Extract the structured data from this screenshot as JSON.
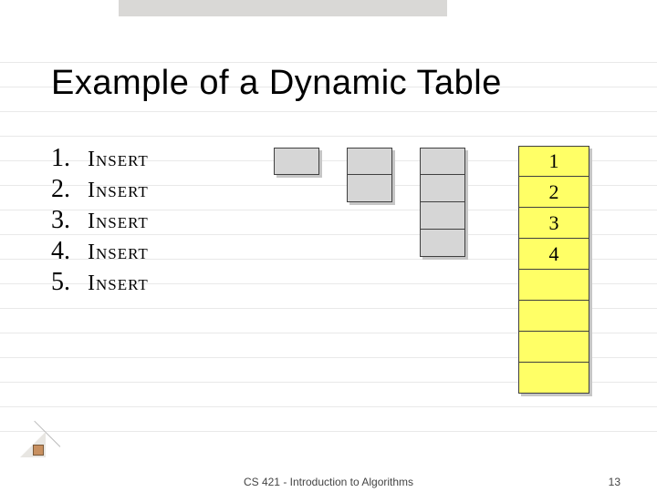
{
  "title": "Example of a Dynamic Table",
  "list": {
    "items": [
      {
        "n": "1.",
        "op": "Insert"
      },
      {
        "n": "2.",
        "op": "Insert"
      },
      {
        "n": "3.",
        "op": "Insert"
      },
      {
        "n": "4.",
        "op": "Insert"
      },
      {
        "n": "5.",
        "op": "Insert"
      }
    ]
  },
  "big_table": {
    "slots": [
      "1",
      "2",
      "3",
      "4",
      "",
      "",
      "",
      ""
    ]
  },
  "footer": {
    "course": "CS 421 - Introduction to Algorithms",
    "page": "13"
  },
  "colors": {
    "highlight": "#ffff66",
    "grey_fill": "#d6d6d6"
  },
  "chart_data": {
    "type": "table",
    "title": "Example of a Dynamic Table",
    "intermediate_tables": [
      {
        "capacity": 1
      },
      {
        "capacity": 2
      },
      {
        "capacity": 4
      }
    ],
    "current_table": {
      "capacity": 8,
      "filled": 4,
      "contents": [
        1,
        2,
        3,
        4,
        null,
        null,
        null,
        null
      ]
    },
    "operations": [
      "INSERT",
      "INSERT",
      "INSERT",
      "INSERT",
      "INSERT"
    ]
  }
}
